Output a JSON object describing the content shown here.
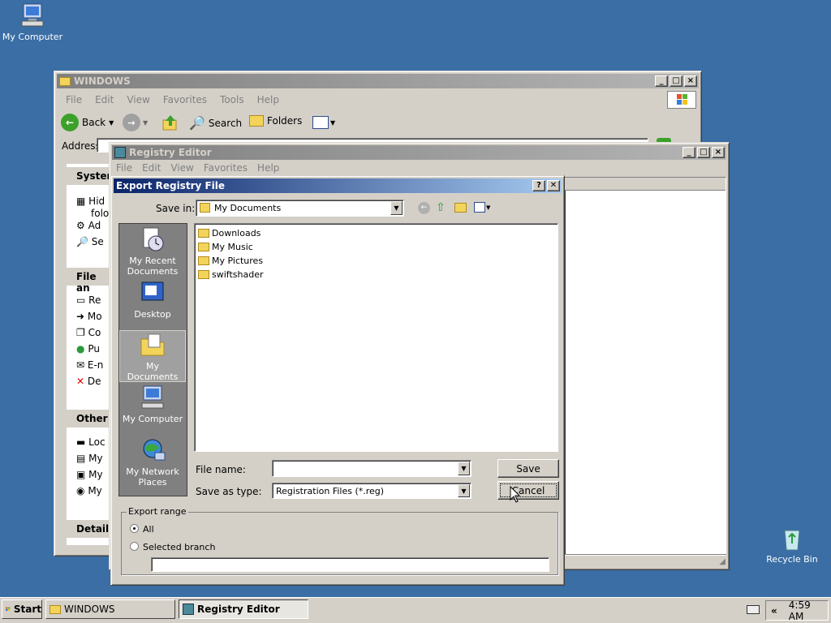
{
  "desktop": {
    "icons": [
      {
        "label": "My Computer",
        "icon": "my-computer-icon"
      },
      {
        "label": "Recycle Bin",
        "icon": "recycle-bin-icon"
      }
    ]
  },
  "explorer": {
    "title": "WINDOWS",
    "menu": [
      "File",
      "Edit",
      "View",
      "Favorites",
      "Tools",
      "Help"
    ],
    "toolbar": {
      "back": "Back",
      "search": "Search",
      "folders": "Folders"
    },
    "address_label": "Address",
    "panels": [
      {
        "title": "System",
        "items": [
          "Hid",
          "folo",
          "Ad",
          "Se"
        ]
      },
      {
        "title": "File an",
        "items": [
          "Re",
          "Mo",
          "Co",
          "Pu",
          "E-n",
          "De"
        ]
      },
      {
        "title": "Other",
        "items": [
          "Loc",
          "My",
          "My",
          "My"
        ]
      },
      {
        "title": "Details",
        "items": []
      }
    ]
  },
  "regedit": {
    "title": "Registry Editor",
    "menu": [
      "File",
      "Edit",
      "View",
      "Favorites",
      "Help"
    ]
  },
  "dialog": {
    "title": "Export Registry File",
    "help_btn": "?",
    "close_btn": "✕",
    "save_in_label": "Save in:",
    "save_in_value": "My Documents",
    "places": [
      {
        "label": "My Recent Documents",
        "icon": "recent-documents-icon"
      },
      {
        "label": "Desktop",
        "icon": "desktop-icon"
      },
      {
        "label": "My Documents",
        "icon": "my-documents-icon",
        "selected": true
      },
      {
        "label": "My Computer",
        "icon": "my-computer-icon"
      },
      {
        "label": "My Network Places",
        "icon": "network-places-icon"
      }
    ],
    "files": [
      "Downloads",
      "My Music",
      "My Pictures",
      "swiftshader"
    ],
    "file_name_label": "File name:",
    "file_name_value": "",
    "save_as_type_label": "Save as type:",
    "save_as_type_value": "Registration Files (*.reg)",
    "save_btn": "Save",
    "cancel_btn": "Cancel",
    "export_range_label": "Export range",
    "radio_all": "All",
    "radio_selected": "Selected branch",
    "branch_value": ""
  },
  "taskbar": {
    "start": "Start",
    "tasks": [
      {
        "label": "WINDOWS",
        "active": false
      },
      {
        "label": "Registry Editor",
        "active": true
      }
    ],
    "tray_arrow": "«",
    "clock": "4:59 AM"
  }
}
